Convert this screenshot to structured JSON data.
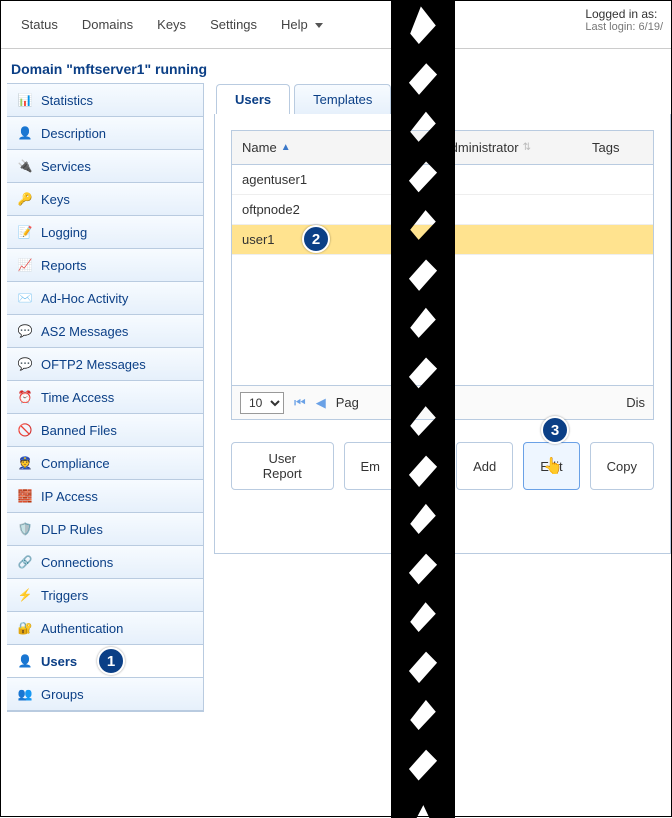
{
  "top_menu": {
    "status": "Status",
    "domains": "Domains",
    "keys": "Keys",
    "settings": "Settings",
    "help": "Help"
  },
  "login_info": {
    "line1": "Logged in as:",
    "line2": "Last login: 6/19/"
  },
  "domain_title": "Domain \"mftserver1\" running",
  "sidebar": {
    "items": [
      {
        "label": "Statistics"
      },
      {
        "label": "Description"
      },
      {
        "label": "Services"
      },
      {
        "label": "Keys"
      },
      {
        "label": "Logging"
      },
      {
        "label": "Reports"
      },
      {
        "label": "Ad-Hoc Activity"
      },
      {
        "label": "AS2 Messages"
      },
      {
        "label": "OFTP2 Messages"
      },
      {
        "label": "Time Access"
      },
      {
        "label": "Banned Files"
      },
      {
        "label": "Compliance"
      },
      {
        "label": "IP Access"
      },
      {
        "label": "DLP Rules"
      },
      {
        "label": "Connections"
      },
      {
        "label": "Triggers"
      },
      {
        "label": "Authentication"
      },
      {
        "label": "Users"
      },
      {
        "label": "Groups"
      }
    ]
  },
  "tabs": {
    "users": "Users",
    "templates": "Templates"
  },
  "grid": {
    "headers": {
      "name": "Name",
      "admin": "Administrator",
      "tags": "Tags"
    },
    "rows": [
      {
        "name": "agentuser1"
      },
      {
        "name": "oftpnode2"
      },
      {
        "name": "user1"
      }
    ],
    "pager": {
      "page_size": "10",
      "page_label": "Pag",
      "display_label": "Dis"
    }
  },
  "buttons": {
    "user_report": "User Report",
    "em": "Em",
    "add": "Add",
    "edit": "Edit",
    "copy": "Copy"
  },
  "annotations": {
    "a1": "1",
    "a2": "2",
    "a3": "3"
  }
}
